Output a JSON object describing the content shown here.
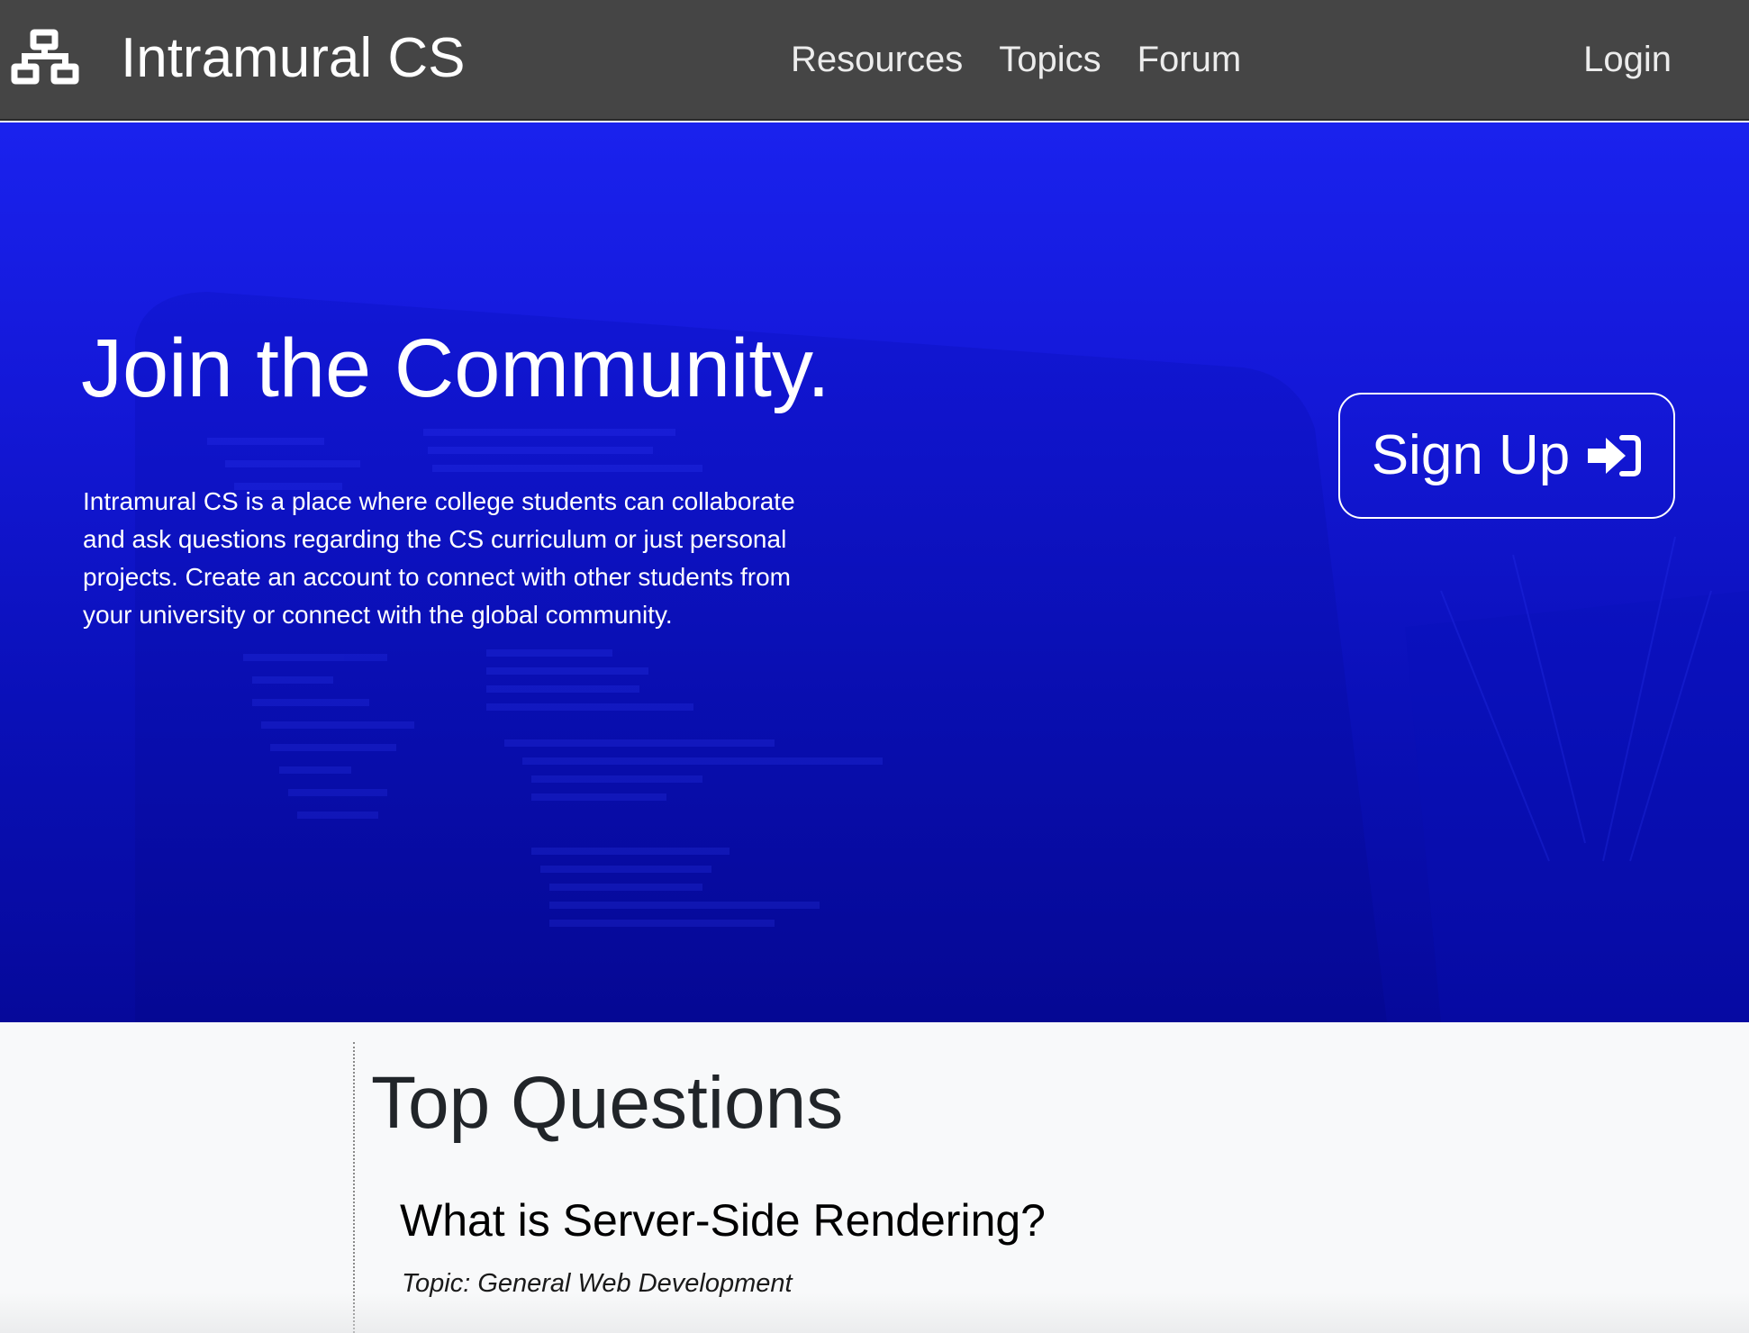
{
  "navbar": {
    "brand_icon": "network-sitemap-icon",
    "brand_name": "Intramural CS",
    "links": [
      {
        "label": "Resources"
      },
      {
        "label": "Topics"
      },
      {
        "label": "Forum"
      }
    ],
    "login_label": "Login",
    "background_color": "#454545"
  },
  "hero": {
    "title": "Join the Community.",
    "description": "Intramural CS is a place where college students can collaborate and ask questions regarding the CS curriculum or just personal projects. Create an account to connect with other students from your university or connect with the global community.",
    "signup_label": "Sign Up",
    "signup_icon": "sign-in-arrow-icon",
    "background_color": "#1418d8"
  },
  "content": {
    "section_title": "Top Questions",
    "questions": [
      {
        "title": "What is Server-Side Rendering?",
        "topic_prefix": "Topic:",
        "topic": "General Web Development"
      }
    ]
  }
}
